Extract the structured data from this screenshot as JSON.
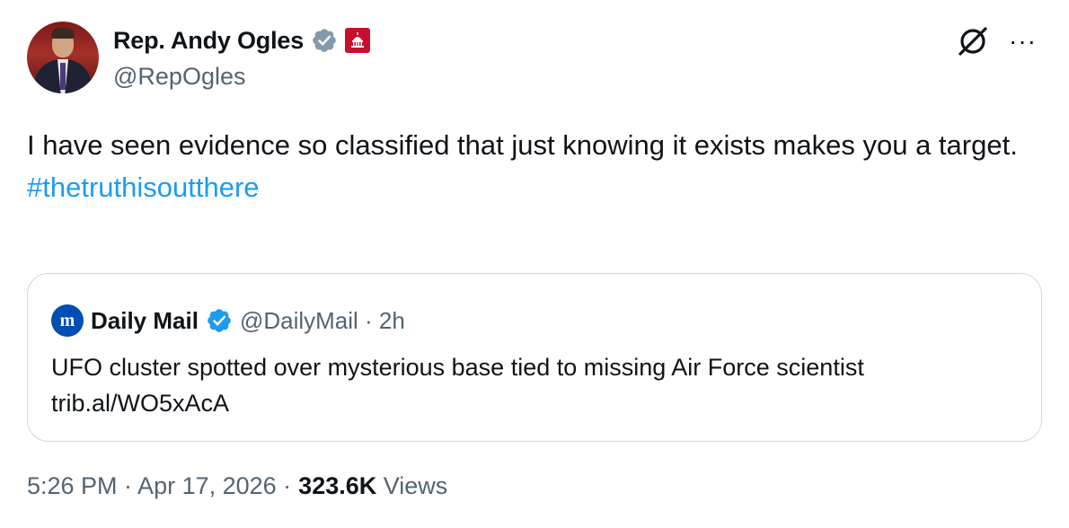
{
  "author": {
    "display_name": "Rep. Andy Ogles",
    "handle": "@RepOgles",
    "verified_icon": "verified-badge-icon",
    "affiliation_icon": "us-house-seal-icon"
  },
  "actions": {
    "grok_icon": "grok-icon",
    "more_label": "···"
  },
  "tweet": {
    "text": "I have seen evidence so classified that just knowing it exists makes you a target.",
    "hashtag": "#thetruthisoutthere"
  },
  "quoted": {
    "logo_text": "m",
    "name": "Daily Mail",
    "handle": "@DailyMail · 2h",
    "text": "UFO cluster spotted over mysterious base tied to missing Air Force scientist trib.al/WO5xAcA"
  },
  "meta": {
    "timestamp": "5:26 PM · Apr 17, 2026 ·",
    "views_count": "323.6K",
    "views_label": "Views"
  },
  "colors": {
    "accent": "#1d9bf0",
    "secondary_text": "#536471",
    "verified_gray": "#829aab",
    "verified_blue": "#1d9bf0",
    "affiliation_red": "#c8102e"
  }
}
